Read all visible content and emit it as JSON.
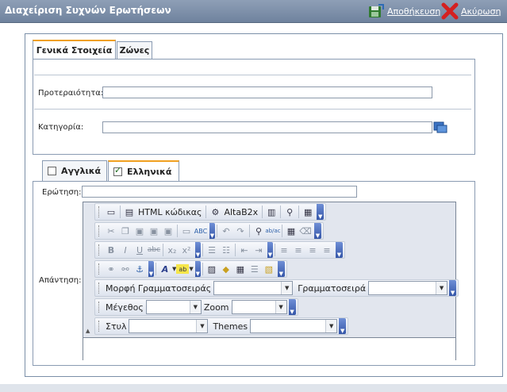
{
  "header": {
    "title": "Διαχείριση Συχνών Ερωτήσεων",
    "save_label": "Αποθήκευση",
    "cancel_label": "Ακύρωση"
  },
  "tabs": [
    {
      "label": "Γενικά Στοιχεία",
      "active": true
    },
    {
      "label": "Ζώνες",
      "active": false
    }
  ],
  "general": {
    "priority_label": "Προτεραιότητα:",
    "priority_value": "",
    "category_label": "Κατηγορία:",
    "category_value": ""
  },
  "language_tabs": [
    {
      "label": "Αγγλικά",
      "checked": false,
      "active": false
    },
    {
      "label": "Ελληνικά",
      "checked": true,
      "active": true
    }
  ],
  "question": {
    "label": "Ερώτηση:",
    "value": ""
  },
  "answer": {
    "label": "Απάντηση:"
  },
  "editor": {
    "html_code_label": "HTML κώδικας",
    "altab2x_label": "AltaB2x",
    "font_format_label": "Μορφή Γραμματοσειράς",
    "font_label": "Γραμματοσειρά",
    "size_label": "Μέγεθος",
    "zoom_label": "Zoom",
    "style_label": "Στυλ",
    "themes_label": "Themes",
    "font_format_value": "",
    "font_value": "",
    "size_value": "",
    "zoom_value": "",
    "style_value": "",
    "themes_value": "",
    "spell_label": "ABC",
    "replace_label": "ab/ac",
    "italic_glyph": "I",
    "underline_glyph": "U",
    "strike_glyph": "abc",
    "subscript_glyph": "x₂",
    "superscript_glyph": "x²",
    "font_color_glyph": "A",
    "highlight_glyph": "ab"
  },
  "colors": {
    "titlebar": "#7f91aa",
    "tab_accent": "#f0a020",
    "toolbar_tail": "#3556a8",
    "panel_border": "#8a9bb2"
  }
}
